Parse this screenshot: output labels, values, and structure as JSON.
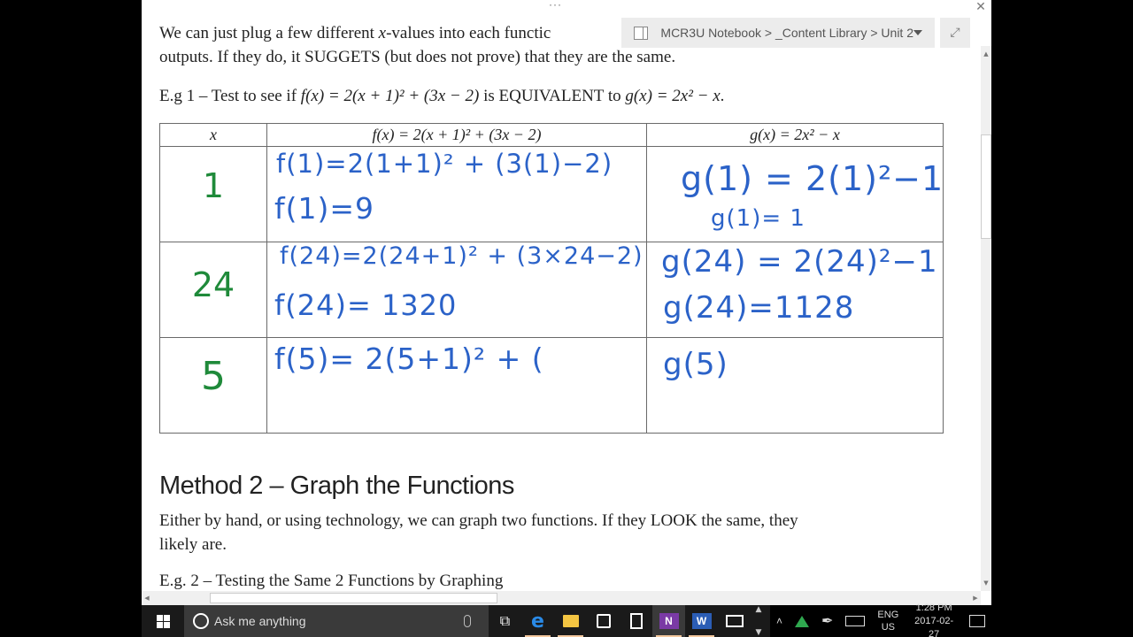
{
  "window": {
    "ellipsis": "···",
    "close_icon": "✕",
    "notebook_path": "MCR3U Notebook > _Content Library > Unit 2",
    "expand_icon": "⤢"
  },
  "page": {
    "intro_line1": "We can just plug a few different ",
    "intro_line1_var": "x",
    "intro_line1_rest": "-values into each functic",
    "intro_line2": "outputs.  If they do, it SUGGETS (but does not prove) that they are the same.",
    "eg1_prefix": "E.g 1 – Test to see if ",
    "eg1_f": "f(x) = 2(x + 1)² + (3x − 2)",
    "eg1_mid": " is EQUIVALENT to ",
    "eg1_g": "g(x) = 2x² − x",
    "eg1_end": "."
  },
  "table": {
    "headers": [
      "x",
      "f(x) = 2(x + 1)² + (3x − 2)",
      "g(x) = 2x² − x"
    ],
    "rows": [
      {
        "x": "1",
        "f_line1": "f(1)=2(1+1)² + (3(1)−2)",
        "f_line2": "f(1)=9",
        "g_line1": "g(1) = 2(1)²−1",
        "g_line2": "g(1)= 1"
      },
      {
        "x": "24",
        "f_line1": "f(24)=2(24+1)² + (3×24−2)",
        "f_line2": "f(24)= 1320",
        "g_line1": "g(24) = 2(24)²−1",
        "g_line2": "g(24)=1128"
      },
      {
        "x": "5",
        "f_line1": "f(5)= 2(5+1)² + (",
        "f_line2": "",
        "g_line1": "g(5)",
        "g_line2": ""
      }
    ]
  },
  "method2": {
    "heading": "Method 2 – Graph the Functions",
    "body_line1": "Either by hand, or using technology, we can graph two functions.  If they LOOK the same, they",
    "body_line2": "likely are.",
    "eg2": "E.g. 2 – Testing the Same 2 Functions by Graphing"
  },
  "taskbar": {
    "search_placeholder": "Ask me anything",
    "apps": [
      "task-view",
      "edge",
      "file-explorer",
      "store",
      "calculator",
      "onenote",
      "word",
      "mail"
    ],
    "lang_line1": "ENG",
    "lang_line2": "US",
    "time": "1:28 PM",
    "date": "2017-02-27"
  }
}
